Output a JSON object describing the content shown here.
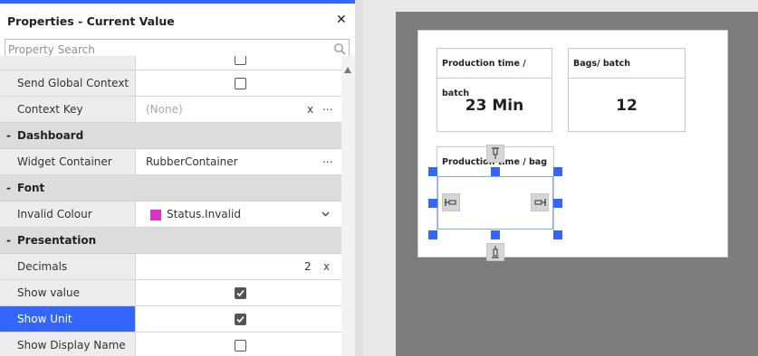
{
  "panel": {
    "title": "Properties - Current Value",
    "close_label": "✕",
    "search": {
      "placeholder": "Property Search",
      "value": ""
    }
  },
  "rows": {
    "send_global_context": {
      "label": "Send Global Context",
      "checked": false
    },
    "context_key": {
      "label": "Context Key",
      "value": "(None)",
      "clear": "x",
      "more": "..."
    },
    "dashboard_section": {
      "label": "Dashboard",
      "toggle": "-"
    },
    "widget_container": {
      "label": "Widget Container",
      "value": "RubberContainer",
      "more": "..."
    },
    "font_section": {
      "label": "Font",
      "toggle": "-"
    },
    "invalid_colour": {
      "label": "Invalid Colour",
      "value": "Status.Invalid",
      "swatch_color": "#d633c9"
    },
    "presentation_section": {
      "label": "Presentation",
      "toggle": "-"
    },
    "decimals": {
      "label": "Decimals",
      "value": "2",
      "clear": "x"
    },
    "show_value": {
      "label": "Show value",
      "checked": true
    },
    "show_unit": {
      "label": "Show Unit",
      "checked": true
    },
    "show_display_name": {
      "label": "Show Display Name",
      "checked": false
    }
  },
  "canvas": {
    "tiles": [
      {
        "header": "Production time / batch",
        "value": "23 Min"
      },
      {
        "header": "Bags/ batch",
        "value": "12"
      },
      {
        "header": "Production time / bag",
        "value": ""
      }
    ]
  },
  "colors": {
    "accent": "#3366ff",
    "selected_row": "#3366ff"
  }
}
